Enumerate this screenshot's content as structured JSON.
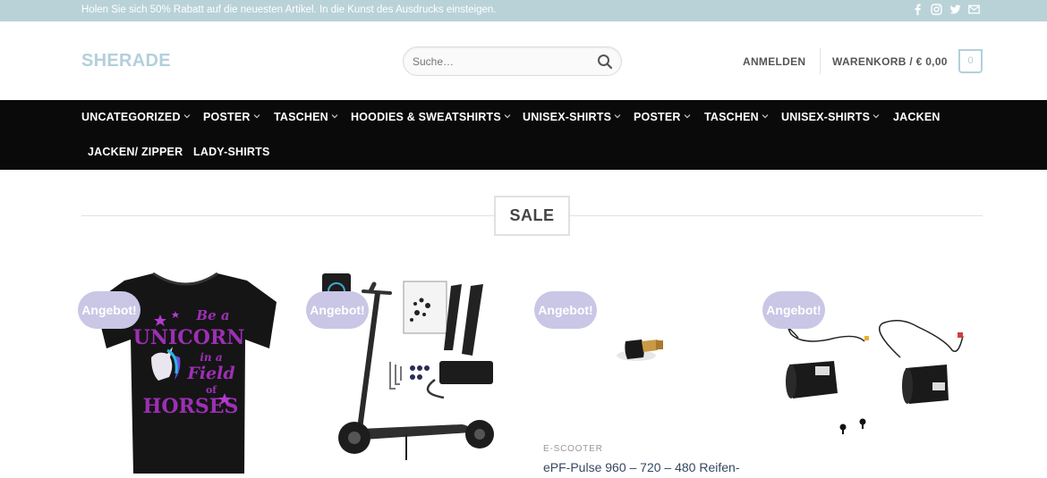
{
  "topbar": {
    "promo": "Holen Sie sich 50% Rabatt auf die neuesten Artikel. In die Kunst des Ausdrucks einsteigen.",
    "social_icons": [
      "facebook-icon",
      "instagram-icon",
      "twitter-icon",
      "email-icon"
    ]
  },
  "header": {
    "logo": "SHERADE",
    "search_placeholder": "Suche…",
    "login": "ANMELDEN",
    "cart": "WARENKORB / € 0,00",
    "cart_count": "0"
  },
  "nav": {
    "items": [
      {
        "label": "UNCATEGORIZED",
        "dropdown": true
      },
      {
        "label": "POSTER",
        "dropdown": true
      },
      {
        "label": "TASCHEN",
        "dropdown": true
      },
      {
        "label": "HOODIES & SWEATSHIRTS",
        "dropdown": true
      },
      {
        "label": "UNISEX-SHIRTS",
        "dropdown": true
      },
      {
        "label": "POSTER",
        "dropdown": true
      },
      {
        "label": "TASCHEN",
        "dropdown": true
      },
      {
        "label": "UNISEX-SHIRTS",
        "dropdown": true
      },
      {
        "label": "JACKEN",
        "dropdown": false
      },
      {
        "label": "JACKEN/ ZIPPER",
        "dropdown": false
      },
      {
        "label": "LADY-SHIRTS",
        "dropdown": false
      }
    ]
  },
  "section": {
    "title": "SALE"
  },
  "products": [
    {
      "badge": "Angebot!",
      "image": "unicorn-tshirt",
      "shirt_text": [
        "Be a",
        "UNICORN",
        "in a",
        "Field",
        "of",
        "HORSES"
      ],
      "category": "",
      "name": ""
    },
    {
      "badge": "Angebot!",
      "image": "e-scooter-kit",
      "category": "",
      "name": ""
    },
    {
      "badge": "Angebot!",
      "image": "tire-valve",
      "category": "E-SCOOTER",
      "name": "ePF-Pulse 960 – 720 – 480 Reifen-"
    },
    {
      "badge": "Angebot!",
      "image": "scooter-motors",
      "category": "",
      "name": ""
    }
  ],
  "colors": {
    "topbar": "#b9d2d8",
    "logo": "#b2d0db",
    "nav_bg": "#0a0a0a",
    "badge": "#c9c6e6",
    "product_name": "#334862"
  }
}
